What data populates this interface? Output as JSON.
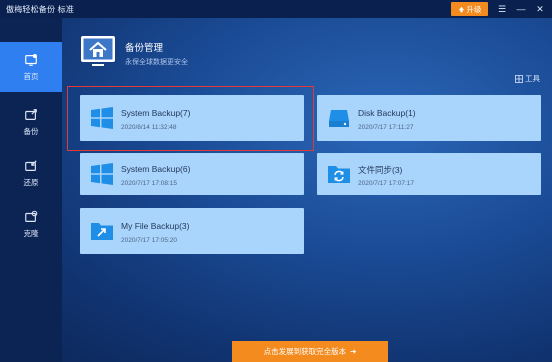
{
  "app": {
    "title": "傲梅轻松备份 标准",
    "upgrade_label": "升级"
  },
  "window_controls": {
    "menu": "☰",
    "minimize": "—",
    "close": "✕"
  },
  "sidebar": {
    "items": [
      {
        "label": "首页",
        "icon": "home-icon",
        "active": true
      },
      {
        "label": "备份",
        "icon": "backup-icon",
        "active": false
      },
      {
        "label": "还原",
        "icon": "restore-icon",
        "active": false
      },
      {
        "label": "克隆",
        "icon": "clone-icon",
        "active": false
      }
    ]
  },
  "header": {
    "title": "备份管理",
    "subtitle": "永保全球数据更安全",
    "tools_label": "工具"
  },
  "tasks": [
    {
      "name": "System Backup(7)",
      "time": "2020/8/14 11:32:48",
      "icon": "windows-icon",
      "selected": true
    },
    {
      "name": "Disk Backup(1)",
      "time": "2020/7/17 17:11:27",
      "icon": "disk-icon",
      "selected": false
    },
    {
      "name": "System Backup(6)",
      "time": "2020/7/17 17:08:15",
      "icon": "windows-icon",
      "selected": false
    },
    {
      "name": "文件同步(3)",
      "time": "2020/7/17 17:07:17",
      "icon": "sync-folder-icon",
      "selected": false
    },
    {
      "name": "My File Backup(3)",
      "time": "2020/7/17 17:05:20",
      "icon": "file-backup-folder-icon",
      "selected": false
    }
  ],
  "bottom": {
    "button_label": "点击发展到获取完全版本",
    "arrow": "➜"
  },
  "colors": {
    "accent_orange": "#f38b1f",
    "sidebar_active": "#2f7ff0",
    "card_bg": "#a9d4fb",
    "selection_red": "#e23a36"
  }
}
